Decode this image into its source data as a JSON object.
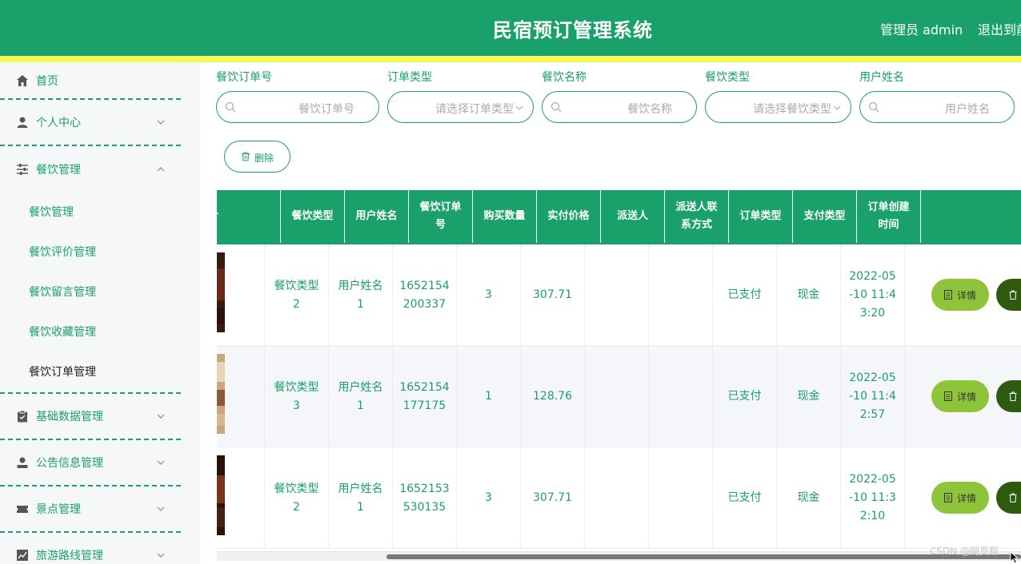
{
  "header": {
    "title": "民宿预订管理系统",
    "admin_label": "管理员 admin",
    "logout_label": "退出到前"
  },
  "colors": {
    "primary": "#1aa06b",
    "accent_strip": "#f6f854",
    "detail_button": "#8ec43a",
    "delete_button": "#2d5a0e"
  },
  "sidebar": {
    "items": [
      {
        "label": "首页",
        "icon": "home-icon"
      },
      {
        "label": "个人中心",
        "icon": "user-icon"
      },
      {
        "label": "餐饮管理",
        "icon": "sliders-icon",
        "expanded": true
      },
      {
        "label": "基础数据管理",
        "icon": "clipboard-icon"
      },
      {
        "label": "公告信息管理",
        "icon": "user-icon"
      },
      {
        "label": "景点管理",
        "icon": "ticket-icon"
      },
      {
        "label": "旅游路线管理",
        "icon": "chart-icon"
      }
    ],
    "submenu": [
      {
        "label": "餐饮管理"
      },
      {
        "label": "餐饮评价管理"
      },
      {
        "label": "餐饮留言管理"
      },
      {
        "label": "餐饮收藏管理"
      },
      {
        "label": "餐饮订单管理",
        "active": true
      }
    ]
  },
  "search": {
    "fields": [
      {
        "label": "餐饮订单号",
        "placeholder": "餐饮订单号",
        "type": "input"
      },
      {
        "label": "订单类型",
        "placeholder": "请选择订单类型",
        "type": "select"
      },
      {
        "label": "餐饮名称",
        "placeholder": "餐饮名称",
        "type": "input"
      },
      {
        "label": "餐饮类型",
        "placeholder": "请选择餐饮类型",
        "type": "select"
      },
      {
        "label": "用户姓名",
        "placeholder": "用户姓名",
        "type": "input"
      }
    ]
  },
  "toolbar": {
    "delete_label": "删除"
  },
  "table": {
    "columns": [
      "片",
      "餐饮类型",
      "用户姓名",
      "餐饮订单号",
      "购买数量",
      "实付价格",
      "派送人",
      "派送人联系方式",
      "订单类型",
      "支付类型",
      "订单创建时间",
      ""
    ],
    "rows": [
      {
        "food_type": "餐饮类型2",
        "user_name": "用户姓名1",
        "order_no": "1652154200337",
        "quantity": "3",
        "price": "307.71",
        "courier": "",
        "courier_phone": "",
        "order_type": "已支付",
        "pay_type": "现金",
        "created_at": "2022-05-10 11:43:20"
      },
      {
        "food_type": "餐饮类型3",
        "user_name": "用户姓名1",
        "order_no": "1652154177175",
        "quantity": "1",
        "price": "128.76",
        "courier": "",
        "courier_phone": "",
        "order_type": "已支付",
        "pay_type": "现金",
        "created_at": "2022-05-10 11:42:57"
      },
      {
        "food_type": "餐饮类型2",
        "user_name": "用户姓名1",
        "order_no": "1652153530135",
        "quantity": "3",
        "price": "307.71",
        "courier": "",
        "courier_phone": "",
        "order_type": "已支付",
        "pay_type": "现金",
        "created_at": "2022-05-10 11:32:10"
      }
    ],
    "detail_label": "详情"
  },
  "watermark": "CSDN @网页帮"
}
